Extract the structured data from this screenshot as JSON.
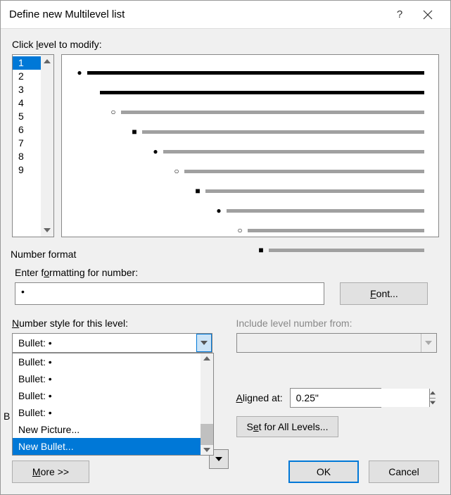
{
  "title": "Define new Multilevel list",
  "help_symbol": "?",
  "levels_label_pre": "Click ",
  "levels_label_u": "l",
  "levels_label_post": "evel to modify:",
  "levels": [
    "1",
    "2",
    "3",
    "4",
    "5",
    "6",
    "7",
    "8",
    "9"
  ],
  "selected_level_index": 0,
  "number_format_header": "Number format",
  "formatting_label_pre": "Enter f",
  "formatting_label_u": "o",
  "formatting_label_post": "rmatting for number:",
  "formatting_value": "•",
  "font_button_u": "F",
  "font_button_post": "ont...",
  "numstyle_label_u": "N",
  "numstyle_label_post": "umber style for this level:",
  "numstyle_value": "Bullet: •",
  "numstyle_options": [
    "Bullet:  •",
    "Bullet:  •",
    "Bullet:  •",
    "Bullet:  •",
    "New Picture...",
    "New Bullet..."
  ],
  "numstyle_highlight_index": 5,
  "include_label": "Include level number from:",
  "bullet_partial": "B",
  "aligned_label_pre": "",
  "aligned_label_u": "A",
  "aligned_label_post": "ligned at:",
  "aligned_value": "0.25\"",
  "setall_pre": "S",
  "setall_u": "e",
  "setall_post": "t for All Levels...",
  "more_u": "M",
  "more_post": "ore >>",
  "ok_label": "OK",
  "cancel_label": "Cancel"
}
